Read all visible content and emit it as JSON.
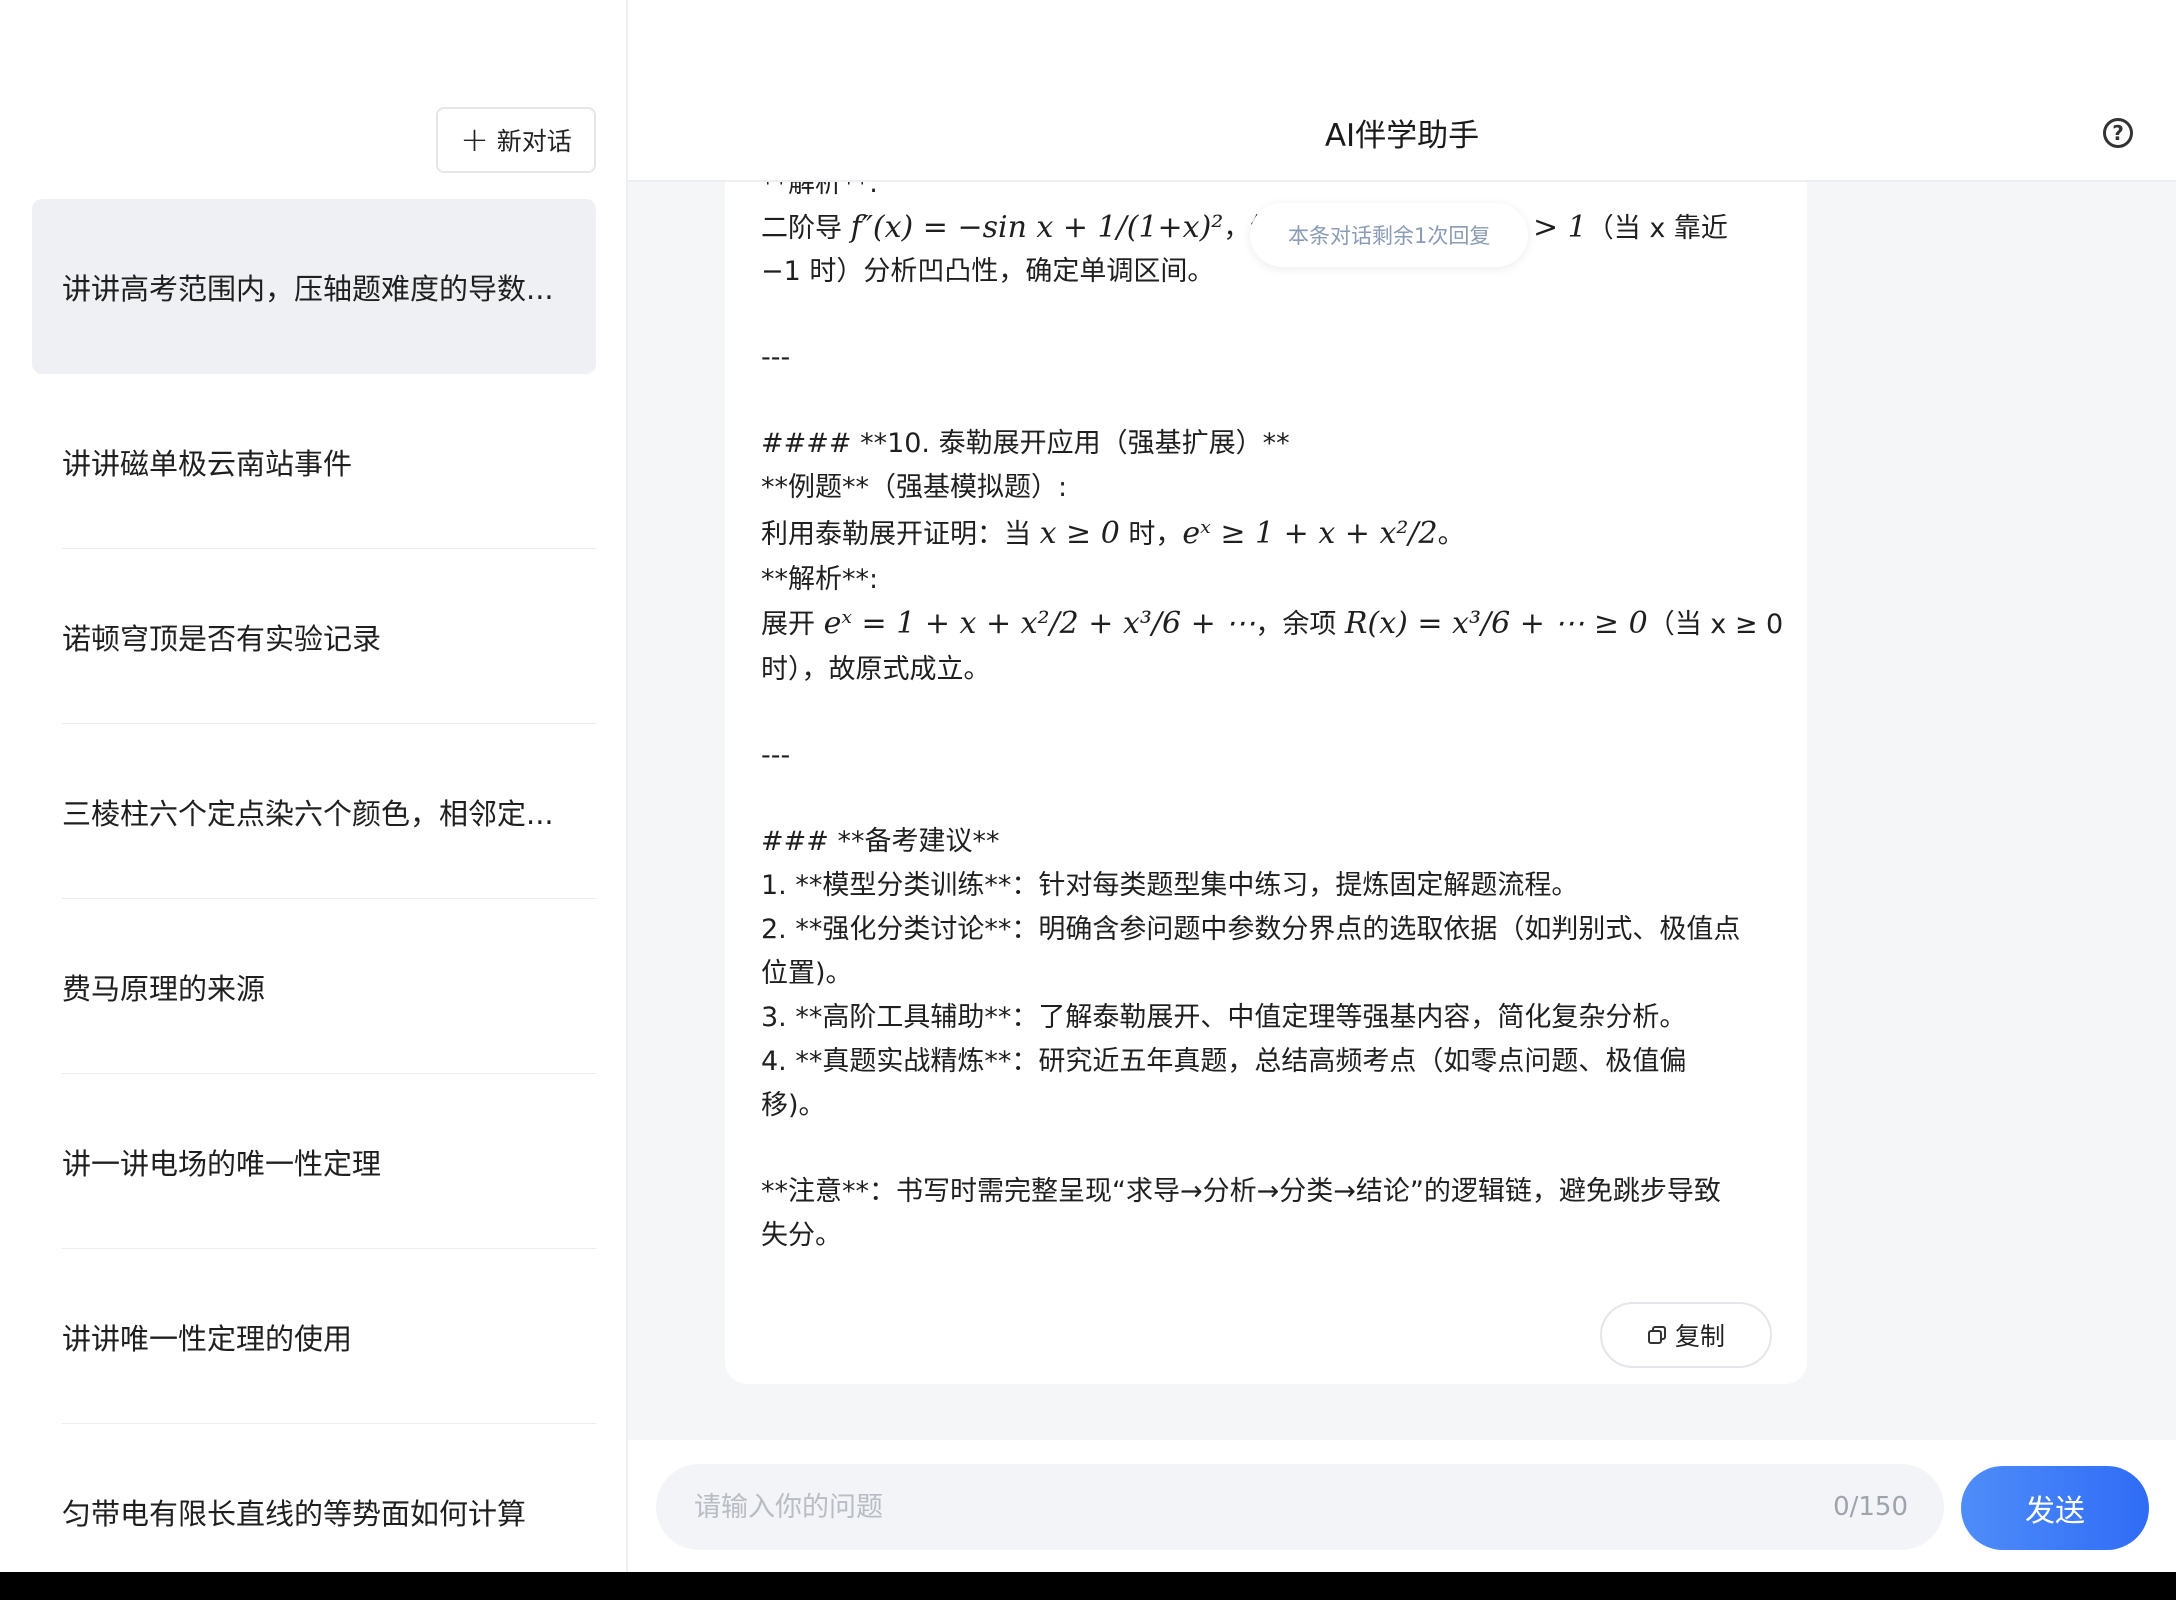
{
  "sidebar": {
    "new_chat_label": "新对话",
    "conversations": [
      "讲讲高考范围内，压轴题难度的导数...",
      "讲讲磁单极云南站事件",
      "诺顿穹顶是否有实验记录",
      "三棱柱六个定点染六个颜色，相邻定...",
      "费马原理的来源",
      "讲一讲电场的唯一性定理",
      "讲讲唯一性定理的使用",
      "匀带电有限长直线的等势面如何计算"
    ]
  },
  "header": {
    "title": "AI伴学助手"
  },
  "badge": {
    "text": "本条对话剩余1次回复"
  },
  "message": {
    "l1": "**解析**:",
    "l2_pre": "二阶导 ",
    "l2_math": "f″(x) = −sin x + 1/(1+x)²",
    "l2_mid": "，结",
    "l2_math2": "> 1",
    "l2_post": "（当 x 靠近",
    "l3": "−1 时）分析凹凸性，确定单调区间。",
    "sep1": "---",
    "h10": "#### **10. 泰勒展开应用（强基扩展）**",
    "ex_label": "**例题**（强基模拟题）:",
    "ex_pre": "利用泰勒展开证明：当 ",
    "ex_math": "x ≥ 0",
    "ex_mid": " 时，",
    "ex_math2": "eˣ ≥ 1 + x + x²/2",
    "ex_post": "。",
    "an_label": "**解析**:",
    "an_pre": "展开 ",
    "an_math": "eˣ = 1 + x + x²/2 + x³/6 + ⋯",
    "an_mid": "，余项 ",
    "an_math2": "R(x) = x³/6 + ⋯ ≥ 0",
    "an_post": "（当 x ≥ 0",
    "an_l2": "时），故原式成立。",
    "sep2": "---",
    "h_prep": "### **备考建议**",
    "s1": "1. **模型分类训练**：针对每类题型集中练习，提炼固定解题流程。",
    "s2a": "2. **强化分类讨论**：明确含参问题中参数分界点的选取依据（如判别式、极值点",
    "s2b": "位置)。",
    "s3": "3. **高阶工具辅助**：了解泰勒展开、中值定理等强基内容，简化复杂分析。",
    "s4a": "4. **真题实战精炼**：研究近五年真题，总结高频考点（如零点问题、极值偏",
    "s4b": "移)。",
    "note_a": "**注意**：书写时需完整呈现“求导→分析→分类→结论”的逻辑链，避免跳步导致",
    "note_b": "失分。"
  },
  "copy_label": "复制",
  "input": {
    "placeholder": "请输入你的问题",
    "count": "0/150"
  },
  "send_label": "发送"
}
